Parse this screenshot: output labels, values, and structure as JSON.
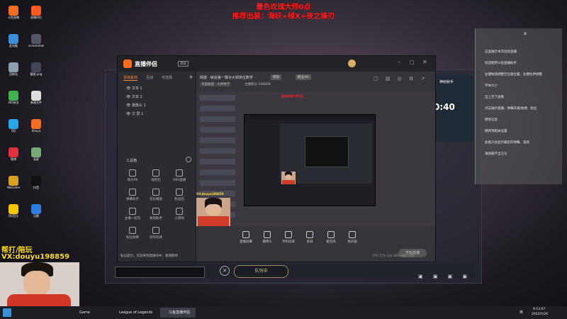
{
  "overlay": {
    "line1": "墨色玫瑰大师0点",
    "line2": "推荐出装：海妖+绿X+夜之锋刃",
    "promo1": "帮打/陪玩",
    "promo2": "VX:douyu198859"
  },
  "desktop_icons": [
    {
      "label": "斗鱼直播",
      "color": "#f36c21"
    },
    {
      "label": "此电脑",
      "color": "#3a8fd8"
    },
    {
      "label": "回收站",
      "color": "#8aa0b0"
    },
    {
      "label": "360安全",
      "color": "#3fb34f"
    },
    {
      "label": "QQ",
      "color": "#2aa6e8"
    },
    {
      "label": "微博",
      "color": "#e0303a"
    },
    {
      "label": "WeGame",
      "color": "#d8a020"
    },
    {
      "label": "QQ音乐",
      "color": "#f6c700"
    },
    {
      "label": "直播伴侣",
      "color": "#ff5a1e"
    },
    {
      "label": "screenshot",
      "color": "#556"
    },
    {
      "label": "截图.png",
      "color": "#445"
    },
    {
      "label": "新建文件",
      "color": "#ddd"
    },
    {
      "label": "douyu",
      "color": "#f36c21"
    },
    {
      "label": "录屏",
      "color": "#7a7"
    },
    {
      "label": "抖音",
      "color": "#111"
    },
    {
      "label": "迅雷",
      "color": "#2a7fe0"
    }
  ],
  "window": {
    "app_title": "直播伴侣",
    "version_tag": "测试",
    "tabs": [
      "添加素材",
      "互动",
      "可选择"
    ],
    "sources": [
      "文本 1",
      "文本 2",
      "摄像头 1",
      "文 屏 1"
    ],
    "tools_heading": "工具箱",
    "tools": [
      "观众PK",
      "福利社",
      "OBS直播",
      "弹幕助手",
      "音乐播放",
      "粉丝团",
      "主播一起玩",
      "发现助手",
      "小游戏",
      "粉丝勋章",
      "旧的玩具"
    ],
    "info_line1": "网游 · 峡谷第一赛冰大师排位数学",
    "info_btn": "修改",
    "info_tag": "职业AD",
    "info_line2": "英雄联盟 · 大神教学",
    "info_fans": "主播积分 198859",
    "bottom_tools": [
      "直播屏幕",
      "摄像头",
      "手机投屏",
      "多屏",
      "麦克风",
      "扬声器"
    ],
    "start_button": "开始直播",
    "status_line": "私信提示，欢迎来到直播间中，敬请期待",
    "stats": "CPU 17%  内存 38%  网络 0.0%"
  },
  "right_panel": {
    "head": "神射射手",
    "clock": "0:40",
    "lines": [
      "这里展示本次连续直播",
      "欢迎使用斗鱼直播助手",
      "左键拖拽调整至任意位置，左键拉伸调整",
      "字体大小",
      "自上至下查看",
      "点击展示直播、弹幕开通/收费、粉丝",
      "牌等信息",
      "跳转到相关设置",
      "此框只会显示最近的弹幕、道具",
      "请屏蔽不当言论"
    ]
  },
  "game": {
    "queue_label": "队列中"
  },
  "taskbar": {
    "items": [
      "Game",
      "League of Legends",
      "斗鱼直播伴侣"
    ],
    "time": "9:13:07",
    "date": "2022/5/26",
    "ime": "英"
  }
}
